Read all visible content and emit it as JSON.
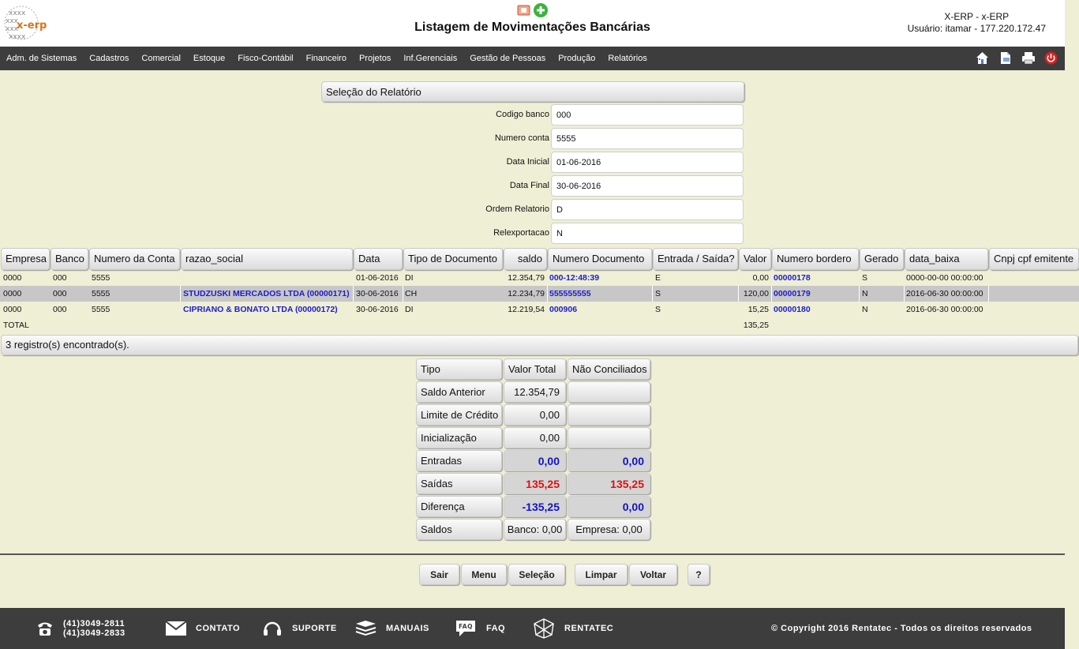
{
  "header": {
    "title": "Listagem de Movimentações Bancárias",
    "system": "X-ERP - x-ERP",
    "user": "Usuário: itamar - 177.220.172.47",
    "logo_text": "x-erp"
  },
  "menu": {
    "items": [
      "Adm. de Sistemas",
      "Cadastros",
      "Comercial",
      "Estoque",
      "Fisco-Contábil",
      "Financeiro",
      "Projetos",
      "Inf.Gerenciais",
      "Gestão de Pessoas",
      "Produção",
      "Relatórios"
    ],
    "icons": [
      "home-icon",
      "document-icon",
      "print-icon",
      "exit-icon"
    ]
  },
  "selection": {
    "header": "Seleção do Relatório",
    "fields": [
      {
        "label": "Codigo banco",
        "value": "000"
      },
      {
        "label": "Numero conta",
        "value": "5555"
      },
      {
        "label": "Data Inicial",
        "value": "01-06-2016"
      },
      {
        "label": "Data Final",
        "value": "30-06-2016"
      },
      {
        "label": "Ordem Relatorio",
        "value": "D"
      },
      {
        "label": "Relexportacao",
        "value": "N"
      }
    ]
  },
  "results": {
    "columns": [
      "Empresa",
      "Banco",
      "Numero da Conta",
      "razao_social",
      "Data",
      "Tipo de Documento",
      "saldo",
      "Numero Documento",
      "Entrada / Saída?",
      "Valor",
      "Numero bordero",
      "Gerado",
      "data_baixa",
      "Cnpj cpf emitente"
    ],
    "rows": [
      {
        "empresa": "0000",
        "banco": "000",
        "conta": "5555",
        "razao": "",
        "data": "01-06-2016",
        "tipo": "DI",
        "saldo": "12.354,79",
        "documento": "000-12:48:39",
        "es": "E",
        "valor": "0,00",
        "bordero": "00000178",
        "gerado": "S",
        "baixa": "0000-00-00 00:00:00",
        "cnpj": ""
      },
      {
        "empresa": "0000",
        "banco": "000",
        "conta": "5555",
        "razao": "STUDZUSKI MERCADOS LTDA (00000171)",
        "data": "30-06-2016",
        "tipo": "CH",
        "saldo": "12.234,79",
        "documento": "555555555",
        "es": "S",
        "valor": "120,00",
        "bordero": "00000179",
        "gerado": "N",
        "baixa": "2016-06-30 00:00:00",
        "cnpj": ""
      },
      {
        "empresa": "0000",
        "banco": "000",
        "conta": "5555",
        "razao": "CIPRIANO & BONATO LTDA (00000172)",
        "data": "30-06-2016",
        "tipo": "DI",
        "saldo": "12.219,54",
        "documento": "000906",
        "es": "S",
        "valor": "15,25",
        "bordero": "00000180",
        "gerado": "N",
        "baixa": "2016-06-30 00:00:00",
        "cnpj": ""
      }
    ],
    "total_label": "TOTAL",
    "total_value": "135,25",
    "count_text": "3 registro(s) encontrado(s)."
  },
  "summary": {
    "headers": [
      "Tipo",
      "Valor Total",
      "Não Conciliados"
    ],
    "rows": [
      {
        "tipo": "Saldo Anterior",
        "valor": "12.354,79",
        "nao": ""
      },
      {
        "tipo": "Limite de Crédito",
        "valor": "0,00",
        "nao": ""
      },
      {
        "tipo": "Inicialização",
        "valor": "0,00",
        "nao": ""
      },
      {
        "tipo": "Entradas",
        "valor": "0,00",
        "nao": "0,00"
      },
      {
        "tipo": "Saídas",
        "valor": "135,25",
        "nao": "135,25"
      },
      {
        "tipo": "Diferença",
        "valor": "-135,25",
        "nao": "0,00"
      },
      {
        "tipo": "Saldos",
        "valor": "Banco: 0,00",
        "nao": "Empresa: 0,00"
      }
    ]
  },
  "buttons": {
    "sair": "Sair",
    "menu": "Menu",
    "selecao": "Seleção",
    "limpar": "Limpar",
    "voltar": "Voltar",
    "help": "?"
  },
  "footer": {
    "phone1": "(41)3049-2811",
    "phone2": "(41)3049-2833",
    "contato": "CONTATO",
    "suporte": "SUPORTE",
    "manuais": "MANUAIS",
    "faq": "FAQ",
    "rentatec": "RENTATEC",
    "copyright": "© Copyright 2016 Rentatec - Todos os direitos reservados"
  },
  "colors": {
    "background": "#efefd6",
    "menubar": "#3d3d3d",
    "link": "#1c1ccc",
    "negative": "#e01010",
    "highlight_row": "#c7c7c7"
  }
}
